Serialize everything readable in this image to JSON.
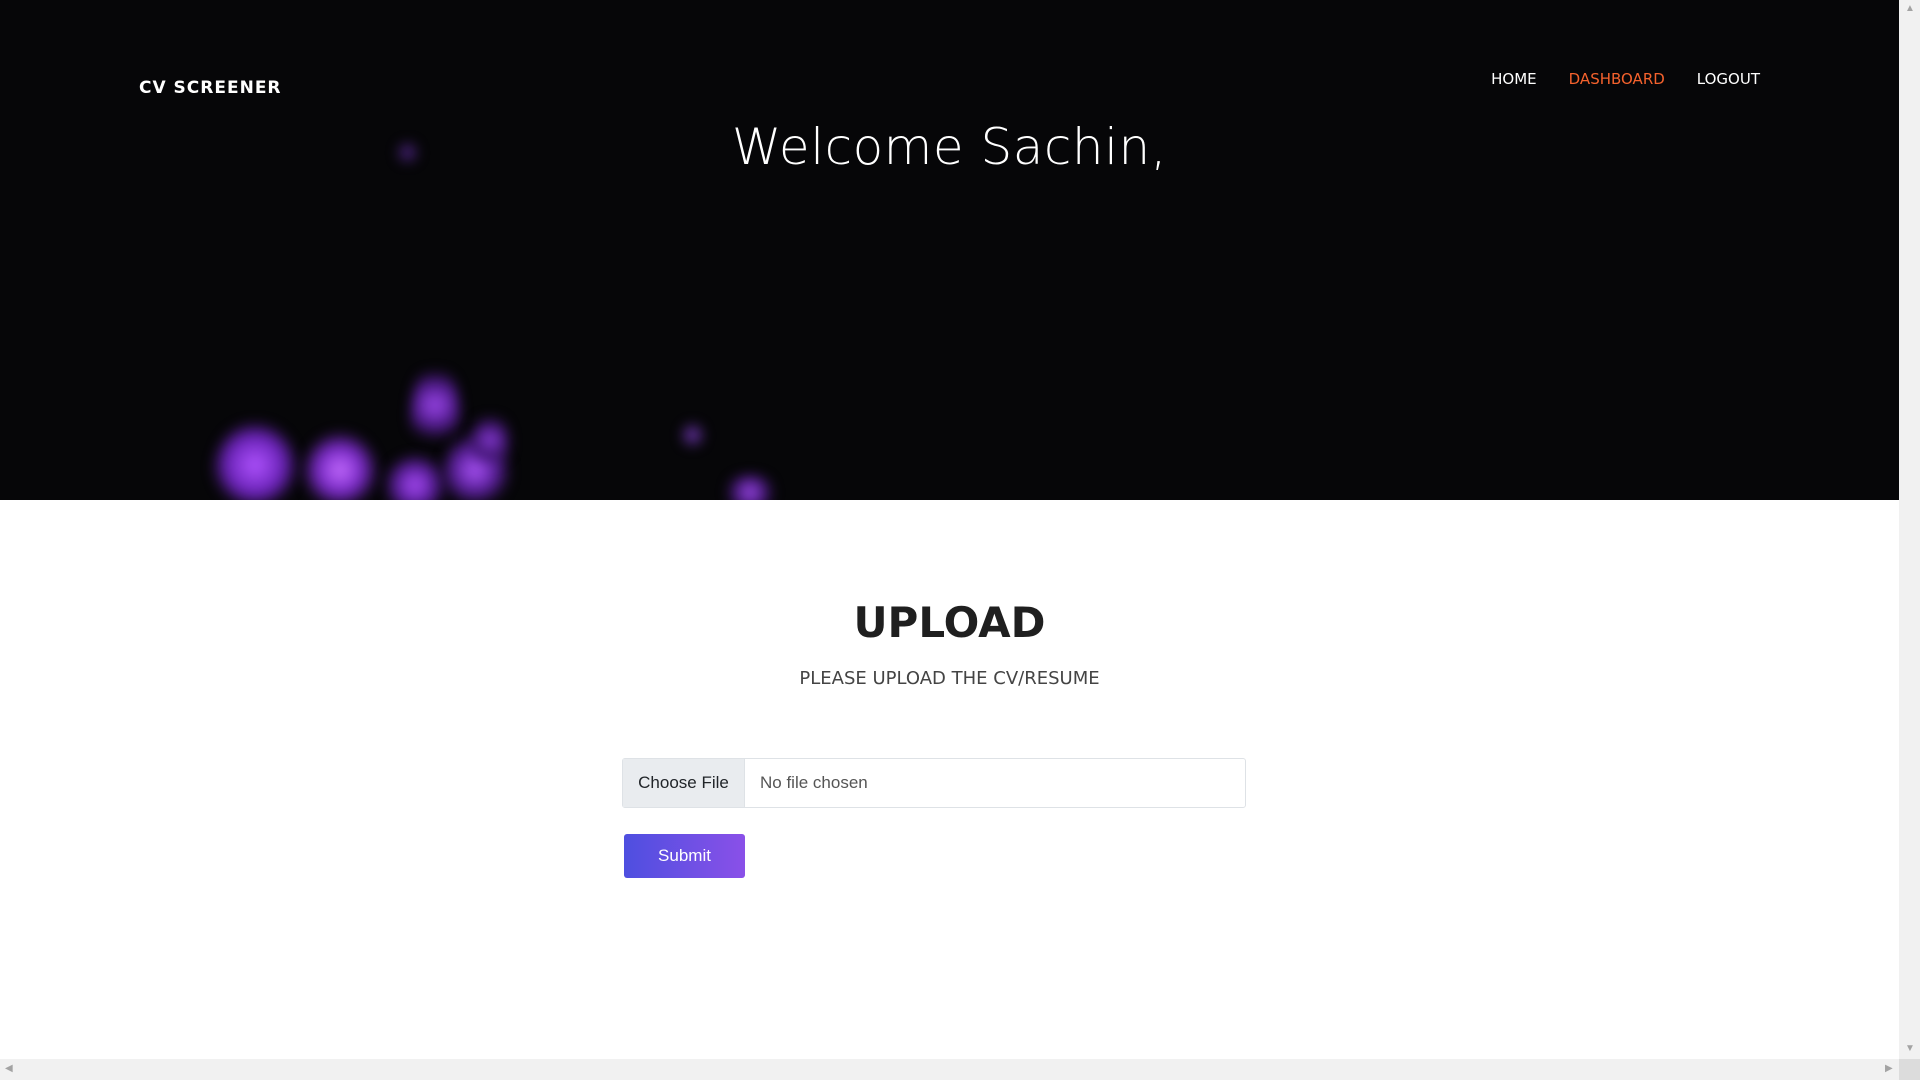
{
  "header": {
    "brand": "CV SCREENER",
    "nav": [
      {
        "label": "HOME",
        "active": false
      },
      {
        "label": "DASHBOARD",
        "active": true
      },
      {
        "label": "LOGOUT",
        "active": false
      }
    ],
    "welcome": "Welcome Sachin,"
  },
  "upload": {
    "title": "UPLOAD",
    "subtitle": "PLEASE UPLOAD THE CV/RESUME",
    "choose_file_label": "Choose File",
    "file_status": "No file chosen",
    "submit_label": "Submit"
  },
  "colors": {
    "hero_bg": "#060608",
    "nav_active": "#f5622d",
    "submit_gradient_start": "#4e4fe0",
    "submit_gradient_end": "#8a50e8",
    "flame": "#9b3fe0"
  },
  "icons": {
    "scroll_up": "chevron-up-icon",
    "scroll_down": "chevron-down-icon",
    "scroll_left": "chevron-left-icon",
    "scroll_right": "chevron-right-icon"
  }
}
